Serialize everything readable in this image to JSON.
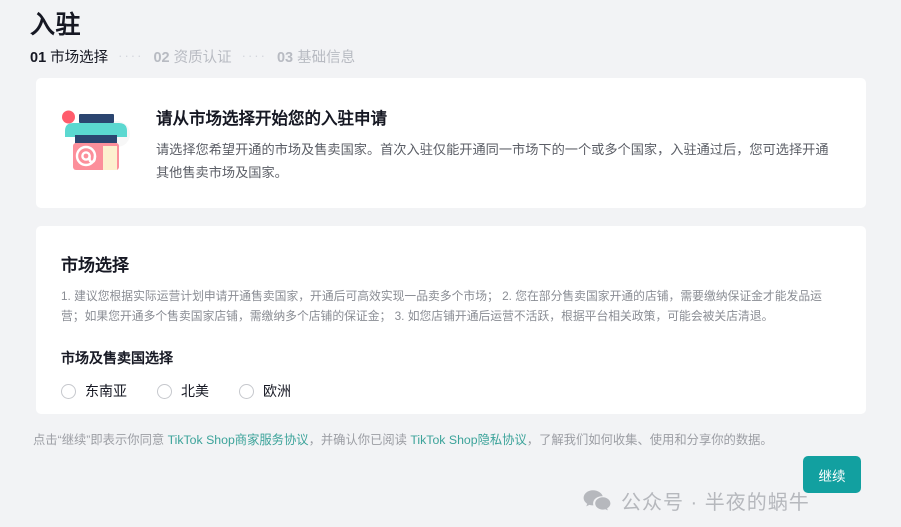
{
  "header": {
    "title": "入驻",
    "steps": [
      {
        "num": "01",
        "label": "市场选择",
        "state": "active"
      },
      {
        "num": "02",
        "label": "资质认证",
        "state": "inactive"
      },
      {
        "num": "03",
        "label": "基础信息",
        "state": "inactive"
      }
    ],
    "step_separator": "····"
  },
  "intro_card": {
    "icon": "shop-storefront-icon",
    "title": "请从市场选择开始您的入驻申请",
    "description": "请选择您希望开通的市场及售卖国家。首次入驻仅能开通同一市场下的一个或多个国家，入驻通过后，您可选择开通其他售卖市场及国家。"
  },
  "market_card": {
    "section_title": "市场选择",
    "note": "1. 建议您根据实际运营计划申请开通售卖国家，开通后可高效实现一品卖多个市场； 2. 您在部分售卖国家开通的店铺，需要缴纳保证金才能发品运营；如果您开通多个售卖国家店铺，需缴纳多个店铺的保证金； 3. 如您店铺开通后运营不活跃，根据平台相关政策，可能会被关店清退。",
    "field_label": "市场及售卖国选择",
    "options": [
      {
        "label": "东南亚",
        "selected": false
      },
      {
        "label": "北美",
        "selected": false
      },
      {
        "label": "欧洲",
        "selected": false
      }
    ]
  },
  "footer": {
    "agreement_prefix": "点击“继续”即表示你同意 ",
    "agreement_link1": "TikTok Shop商家服务协议",
    "agreement_middle": "，并确认你已阅读 ",
    "agreement_link2": "TikTok Shop隐私协议",
    "agreement_suffix": "，了解我们如何收集、使用和分享你的数据。",
    "continue_label": "继续"
  },
  "watermark": {
    "icon": "wechat-icon",
    "text": "公众号 · 半夜的蜗牛"
  },
  "colors": {
    "page_background": "#f2f3f5",
    "card_background": "#ffffff",
    "accent_teal": "#12a0a0",
    "link_teal": "#3ca39a",
    "text_primary": "#161823",
    "text_secondary": "#5b5e66",
    "text_muted": "#8a8d94"
  }
}
